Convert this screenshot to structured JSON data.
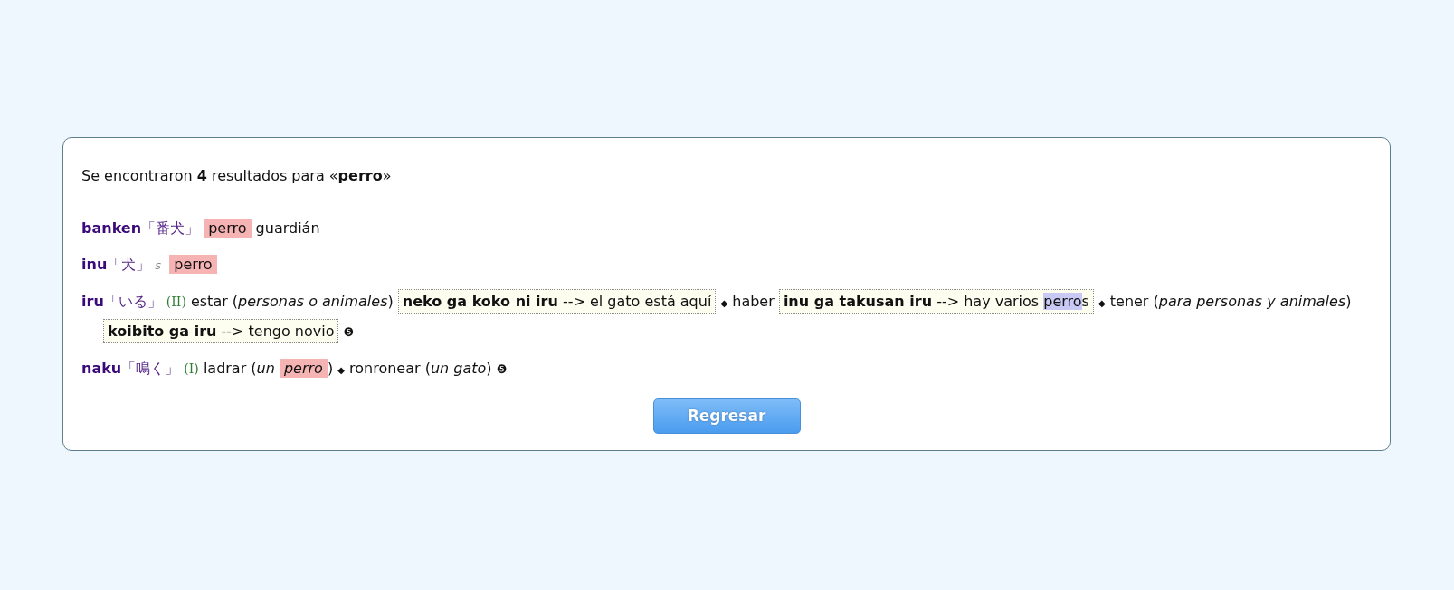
{
  "summary": "Se encontraron **4** resultados para «**perro**»",
  "entries": [
    {
      "segments": [
        {
          "kind": "headword",
          "text": "banken"
        },
        {
          "kind": "kanji",
          "text": "「番犬」"
        },
        {
          "kind": "match",
          "text": "perro"
        },
        {
          "kind": "text",
          "text": "guardián"
        }
      ]
    },
    {
      "segments": [
        {
          "kind": "headword",
          "text": "inu"
        },
        {
          "kind": "kanji",
          "text": "「犬」"
        },
        {
          "kind": "tag",
          "text": "s"
        },
        {
          "kind": "match",
          "text": "perro"
        }
      ]
    },
    {
      "segments": [
        {
          "kind": "headword",
          "text": "iru"
        },
        {
          "kind": "kanji",
          "text": "「いる」"
        },
        {
          "kind": "class",
          "text": "(II)"
        },
        {
          "kind": "text",
          "text": "estar (*personas o animales*)"
        },
        {
          "kind": "example",
          "source": "neko ga koko ni iru",
          "arrow": "-->",
          "target": [
            {
              "kind": "text",
              "text": "el gato está aquí"
            }
          ]
        },
        {
          "kind": "bullet",
          "text": "◆"
        },
        {
          "kind": "text",
          "text": "haber"
        },
        {
          "kind": "example",
          "source": "inu ga takusan iru",
          "arrow": "-->",
          "target": [
            {
              "kind": "text",
              "text": "hay varios"
            },
            {
              "kind": "partial",
              "text": "perro"
            },
            {
              "kind": "glue",
              "text": "s"
            }
          ]
        },
        {
          "kind": "bullet",
          "text": "◆"
        },
        {
          "kind": "text",
          "text": "tener (*para personas y animales*)"
        },
        {
          "kind": "example",
          "source": "koibito ga iru",
          "arrow": "-->",
          "target": [
            {
              "kind": "text",
              "text": "tengo novio"
            }
          ]
        },
        {
          "kind": "note",
          "text": "❺"
        }
      ]
    },
    {
      "segments": [
        {
          "kind": "headword",
          "text": "naku"
        },
        {
          "kind": "kanji",
          "text": "「鳴く」"
        },
        {
          "kind": "class",
          "text": "(I)"
        },
        {
          "kind": "text",
          "text": "ladrar (*un*"
        },
        {
          "kind": "match",
          "text": "perro",
          "italic": true
        },
        {
          "kind": "glue",
          "text": ")"
        },
        {
          "kind": "bullet",
          "text": "◆"
        },
        {
          "kind": "text",
          "text": "ronronear (*un gato*)"
        },
        {
          "kind": "note",
          "text": "❺"
        }
      ]
    }
  ],
  "button": "Regresar"
}
